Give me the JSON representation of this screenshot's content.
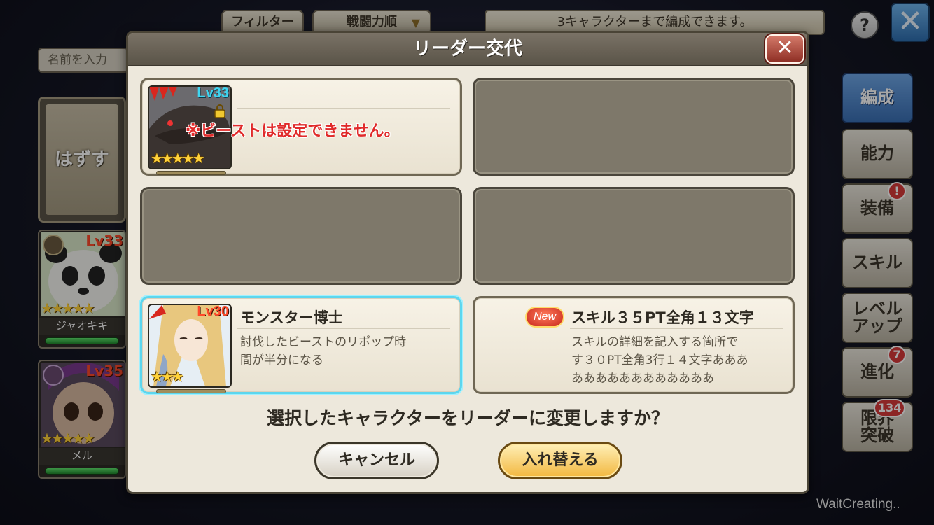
{
  "topbar": {
    "filter_label": "フィルター",
    "sort_label": "戦闘力順",
    "info_text": "3キャラクターまで編成できます。",
    "help_label": "?",
    "close_label": "✕"
  },
  "left": {
    "name_placeholder": "名前を入力",
    "remove_label": "はずす",
    "characters": [
      {
        "name": "ジャオキキ",
        "level": "Lv33",
        "stars": "★★★★★"
      },
      {
        "name": "メル",
        "level": "Lv35",
        "stars": "★★★★★"
      }
    ]
  },
  "sidebar": {
    "tabs": [
      {
        "label": "編成",
        "active": true
      },
      {
        "label": "能力"
      },
      {
        "label": "装備",
        "badge": "!"
      },
      {
        "label": "スキル"
      },
      {
        "label": "レベルアップ",
        "label_line1": "レベル",
        "label_line2": "アップ"
      },
      {
        "label": "進化",
        "badge": "7"
      },
      {
        "label": "限界突破",
        "label_line1": "限界",
        "label_line2": "突破",
        "badge": "134"
      }
    ]
  },
  "dialog": {
    "title": "リーダー交代",
    "close_label": "✕",
    "slots": [
      {
        "level": "Lv33",
        "stars": "★★★★★",
        "warning": "※ビーストは設定できません。"
      },
      {
        "level": "Lv30",
        "stars": "★★★",
        "character_name": "モンスター博士",
        "skill_desc_line1": "討伐したビーストのリポップ時",
        "skill_desc_line2": "間が半分になる"
      },
      {
        "new_label": "New",
        "skill_name": "スキル３５PT全角１３文字",
        "skill_desc_line1": "スキルの詳細を記入する箇所で",
        "skill_desc_line2": "す３０PT全角3行１４文字あああ",
        "skill_desc_line3": "ああああああああああああ"
      }
    ],
    "question": "選択したキャラクターをリーダーに変更しますか？",
    "cancel_label": "キャンセル",
    "confirm_label": "入れ替える"
  },
  "status_text": "WaitCreating..",
  "colors": {
    "selected_outline": "#5cd6ee",
    "warning_text": "#e02a2a",
    "level_cyan": "#3fd5f0",
    "level_red": "#ff4a2a",
    "confirm_button": "#f2b73e"
  }
}
